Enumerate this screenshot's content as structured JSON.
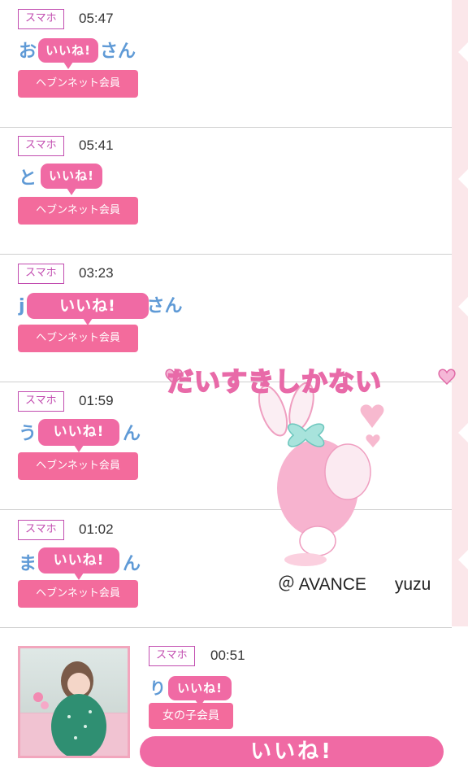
{
  "entries": [
    {
      "device": "スマホ",
      "time": "05:47",
      "name_prefix": "お",
      "name_suffix": "さん",
      "like": "いいね!",
      "member": "ヘブンネット会員"
    },
    {
      "device": "スマホ",
      "time": "05:41",
      "name_prefix": "と",
      "name_suffix": "",
      "like": "いいね!",
      "member": "ヘブンネット会員"
    },
    {
      "device": "スマホ",
      "time": "03:23",
      "name_prefix": "j",
      "name_suffix": "さん",
      "like": "いいね!",
      "member": "ヘブンネット会員"
    },
    {
      "device": "スマホ",
      "time": "01:59",
      "name_prefix": "う",
      "name_suffix": "ん",
      "like": "いいね!",
      "member": "ヘブンネット会員"
    },
    {
      "device": "スマホ",
      "time": "01:02",
      "name_prefix": "ま",
      "name_suffix": "ん",
      "like": "いいね!",
      "member": "ヘブンネット会員"
    }
  ],
  "last_entry": {
    "device": "スマホ",
    "time": "00:51",
    "name_prefix": "り",
    "like": "いいね!",
    "member": "女の子会員"
  },
  "sticker": {
    "title": "だいすきしかない",
    "credit": "＠ AVANCE      yuzu"
  },
  "big_like": "いいね!",
  "colors": {
    "pink": "#f06aa4",
    "member": "#f36b9c",
    "name": "#5f9ad6",
    "badge": "#c24db0"
  }
}
